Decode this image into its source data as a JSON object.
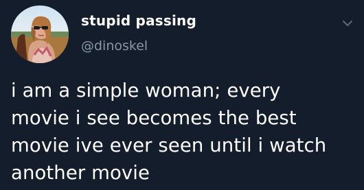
{
  "author": {
    "display_name": "stupid passing",
    "handle": "@dinoskel",
    "avatar_icon": "profile-photo"
  },
  "menu": {
    "icon": "chevron-down-icon"
  },
  "tweet": {
    "lines": [
      "i am a simple woman; every",
      "movie i see becomes the best",
      "movie ive ever seen until i watch",
      "another movie"
    ]
  },
  "colors": {
    "background": "#141d2b",
    "text": "#ffffff",
    "secondary_text": "#8899a6"
  }
}
